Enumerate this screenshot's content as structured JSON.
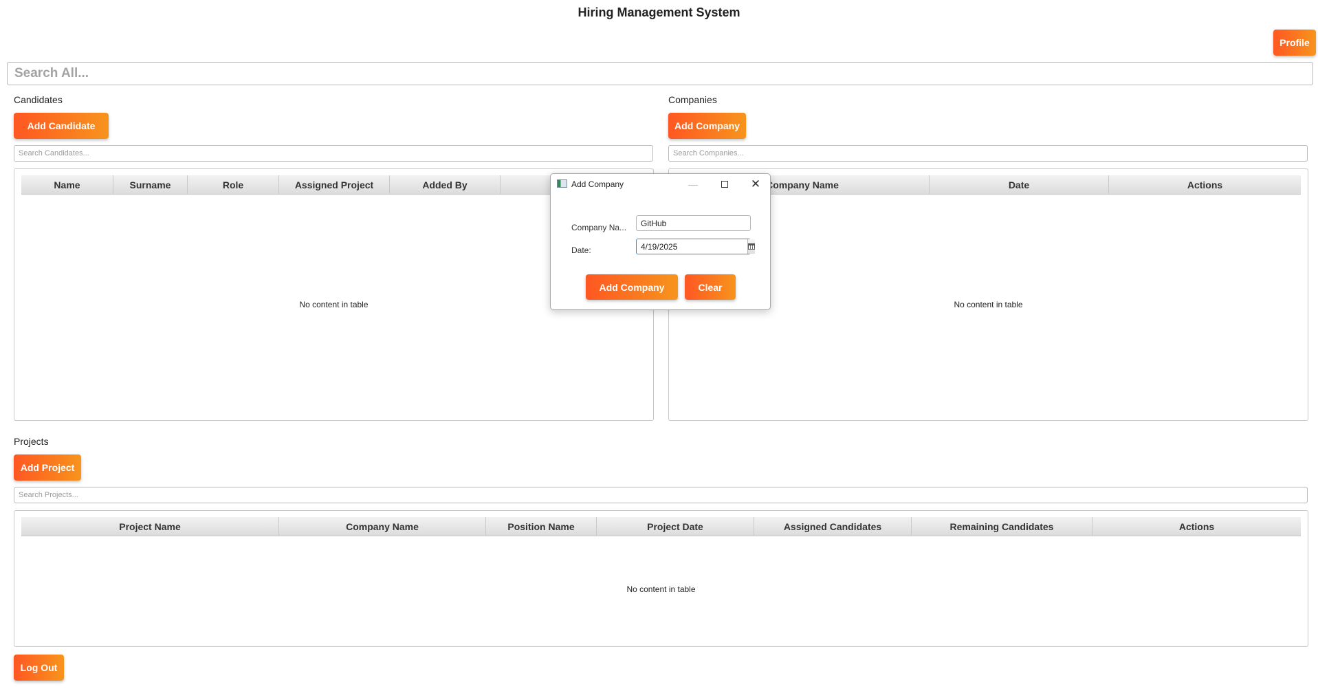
{
  "app": {
    "title": "Hiring Management System",
    "profile_label": "Profile",
    "search_all_placeholder": "Search All...",
    "logout_label": "Log Out"
  },
  "candidates": {
    "label": "Candidates",
    "add_label": "Add Candidate",
    "search_placeholder": "Search Candidates...",
    "columns": [
      "Name",
      "Surname",
      "Role",
      "Assigned Project",
      "Added By",
      ""
    ],
    "empty_text": "No content in table"
  },
  "companies": {
    "label": "Companies",
    "add_label": "Add Company",
    "search_placeholder": "Search Companies...",
    "columns": [
      "Company Name",
      "Date",
      "Actions"
    ],
    "empty_text": "No content in table"
  },
  "projects": {
    "label": "Projects",
    "add_label": "Add Project",
    "search_placeholder": "Search Projects...",
    "columns": [
      "Project Name",
      "Company Name",
      "Position Name",
      "Project Date",
      "Assigned Candidates",
      "Remaining Candidates",
      "Actions"
    ],
    "empty_text": "No content in table"
  },
  "dialog": {
    "title": "Add Company",
    "company_name_label": "Company Na...",
    "company_name_value": "GitHub",
    "date_label": "Date:",
    "date_value": "4/19/2025",
    "add_label": "Add Company",
    "clear_label": "Clear"
  },
  "colors": {
    "accent_start": "#ff5722",
    "accent_end": "#f7941d",
    "focus_border": "#2a8ed6"
  }
}
